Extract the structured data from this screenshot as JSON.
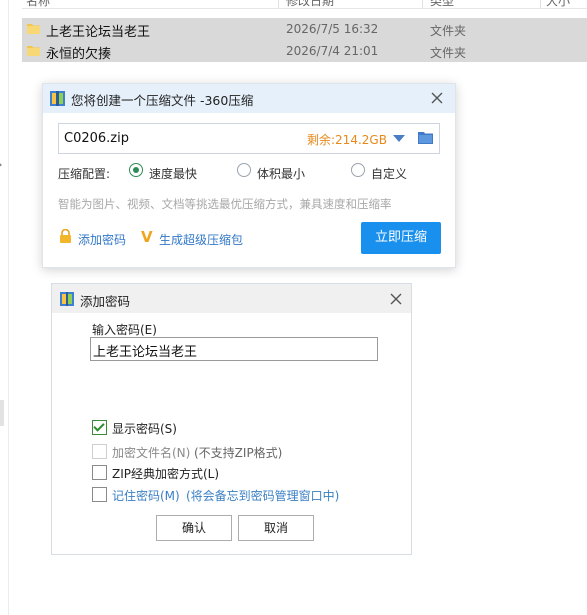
{
  "explorer": {
    "columns": {
      "name": "名称",
      "date": "修改日期",
      "type": "类型",
      "size": "大小"
    },
    "files": [
      {
        "name": "上老王论坛当老王",
        "date": "2026/7/5 16:32",
        "type": "文件夹"
      },
      {
        "name": "永恒的欠揍",
        "date": "2026/7/4 21:01",
        "type": "文件夹"
      }
    ]
  },
  "compress_dialog": {
    "title": "您将创建一个压缩文件 -360压缩",
    "filename": "C0206.zip",
    "remaining_space": "剩余:214.2GB",
    "config_label": "压缩配置:",
    "options": [
      "速度最快",
      "体积最小",
      "自定义"
    ],
    "selected_option": "速度最快",
    "hint": "智能为图片、视频、文档等挑选最优压缩方式，兼具速度和压缩率",
    "add_password_link": "添加密码",
    "create_sfx_link": "生成超级压缩包",
    "compress_button": "立即压缩",
    "accent_color": "#1a90ee"
  },
  "password_dialog": {
    "title": "添加密码",
    "input_label": "输入密码(E)",
    "password_value": "上老王论坛当老王",
    "checkboxes": [
      {
        "label": "显示密码(S)",
        "checked": true,
        "enabled": true
      },
      {
        "label": "加密文件名(N)",
        "note": "(不支持ZIP格式)",
        "checked": false,
        "enabled": false
      },
      {
        "label": "ZIP经典加密方式(L)",
        "checked": false,
        "enabled": true
      },
      {
        "label": "记住密码(M)",
        "note": "(将会备忘到密码管理窗口中)",
        "checked": false,
        "enabled": true
      }
    ],
    "ok_button": "确认",
    "cancel_button": "取消"
  }
}
